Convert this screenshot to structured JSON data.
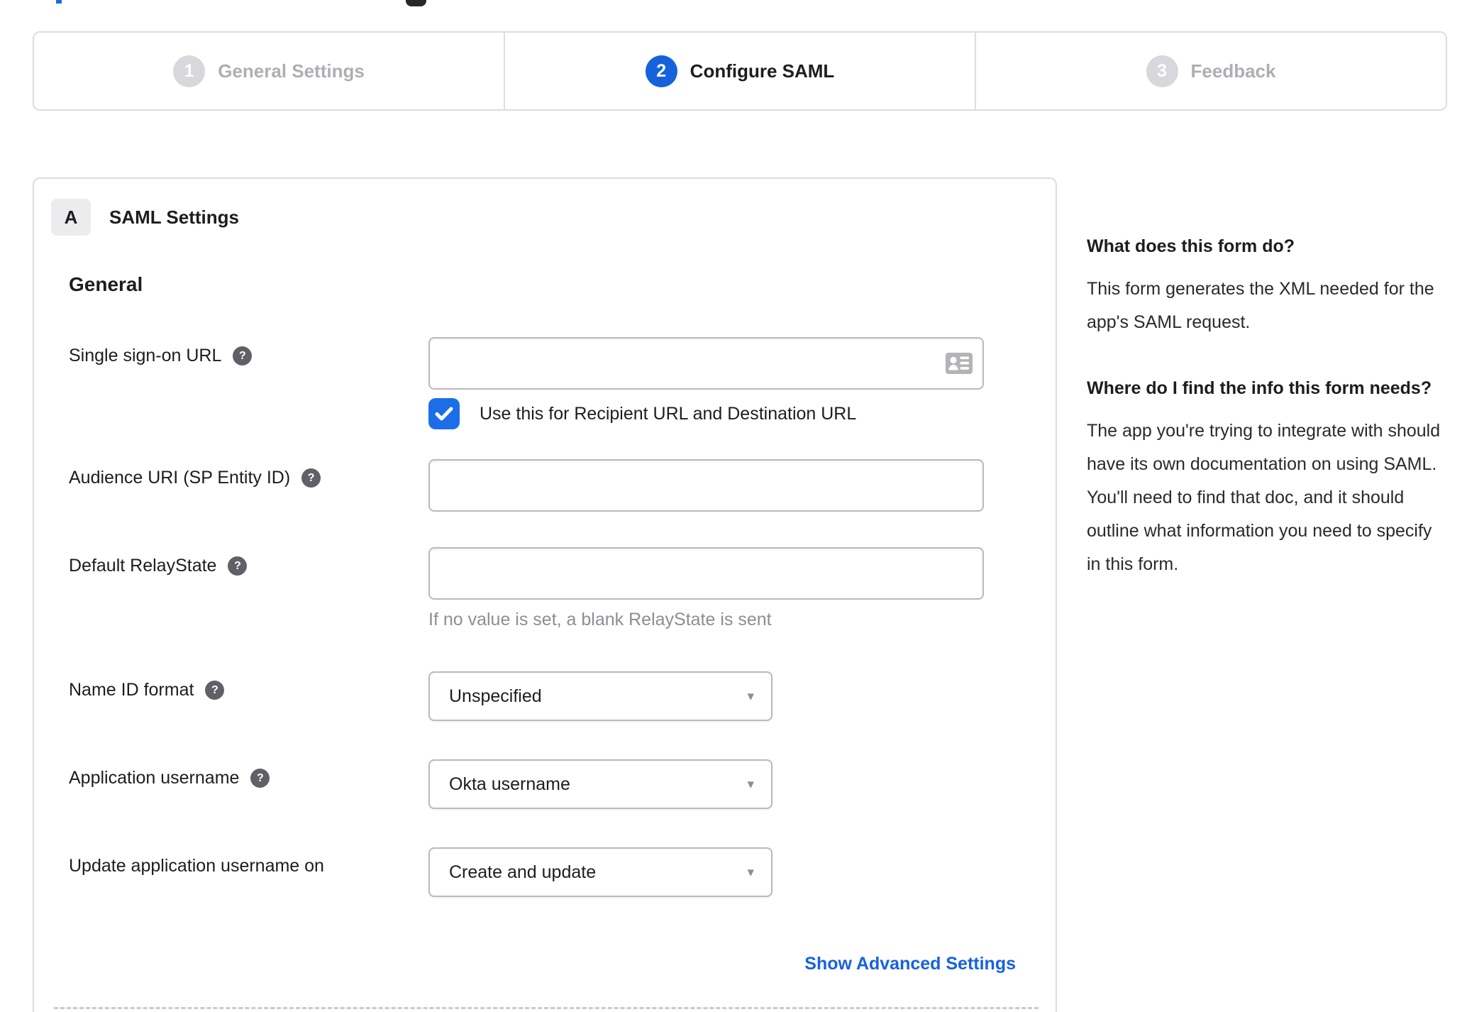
{
  "colors": {
    "accent_blue": "#1662dd",
    "checkbox_blue": "#1c6ee8",
    "link_blue": "#1662dd",
    "border_gray": "#dddde1",
    "inactive_step_gray": "#aeaeb5",
    "hint_gray": "#8d8d95"
  },
  "icons": {
    "help_glyph": "?",
    "caret_glyph": "▾"
  },
  "stepper": {
    "steps": [
      {
        "number": "1",
        "label": "General Settings"
      },
      {
        "number": "2",
        "label": "Configure SAML"
      },
      {
        "number": "3",
        "label": "Feedback"
      }
    ]
  },
  "panel": {
    "section_badge": "A",
    "section_title": "SAML Settings",
    "group_heading": "General",
    "fields": [
      {
        "label": "Single sign-on URL",
        "value": "",
        "checkbox_label": "Use this for Recipient URL and Destination URL",
        "checkbox_checked": true
      },
      {
        "label": "Audience URI (SP Entity ID)",
        "value": ""
      },
      {
        "label": "Default RelayState",
        "value": "",
        "hint": "If no value is set, a blank RelayState is sent"
      },
      {
        "label": "Name ID format",
        "value": "Unspecified"
      },
      {
        "label": "Application username",
        "value": "Okta username"
      },
      {
        "label": "Update application username on",
        "value": "Create and update"
      }
    ],
    "advanced_link": "Show Advanced Settings"
  },
  "sidebar": {
    "sections": [
      {
        "heading": "What does this form do?",
        "body": "This form generates the XML needed for the app's SAML request."
      },
      {
        "heading": "Where do I find the info this form needs?",
        "body": "The app you're trying to integrate with should have its own documentation on using SAML. You'll need to find that doc, and it should outline what information you need to specify in this form."
      }
    ]
  }
}
